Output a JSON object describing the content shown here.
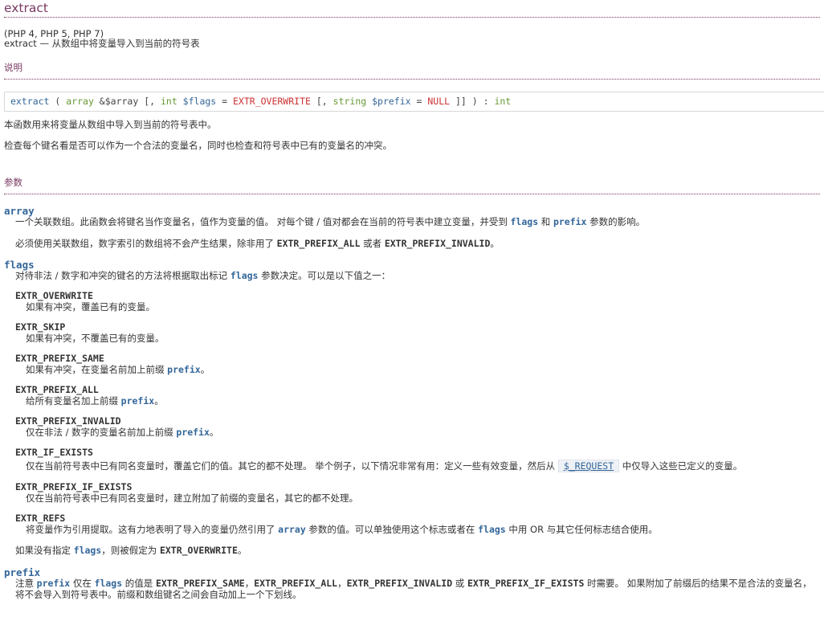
{
  "title": "extract",
  "versions": "(PHP 4, PHP 5, PHP 7)",
  "refpurpose": "extract — 从数组中将变量导入到当前的符号表",
  "section_description": "说明",
  "synopsis": {
    "func": "extract",
    "paren_open": " ( ",
    "t_array": "array",
    "amp_arr": " &$array",
    "bracket1": " [, ",
    "t_int": "int",
    "flags_var": " $flags",
    "eq1": " = ",
    "const_overwrite": "EXTR_OVERWRITE",
    "bracket2": " [, ",
    "t_string": "string",
    "prefix_var": " $prefix",
    "eq2": " = ",
    "const_null": "NULL",
    "closing": " ]] ) : ",
    "t_ret": "int"
  },
  "desc_p1": "本函数用来将变量从数组中导入到当前的符号表中。",
  "desc_p2": "检查每个键名看是否可以作为一个合法的变量名，同时也检查和符号表中已有的变量名的冲突。",
  "section_params": "参数",
  "params": {
    "array": {
      "name": "array",
      "d1_a": "一个关联数组。此函数会将键名当作变量名，值作为变量的值。 对每个键 / 值对都会在当前的符号表中建立变量，并受到 ",
      "d1_flags": "flags",
      "d1_and": " 和 ",
      "d1_prefix": "prefix",
      "d1_b": " 参数的影响。",
      "d2_a": "必须使用关联数组，数字索引的数组将不会产生结果，除非用了 ",
      "d2_c1": "EXTR_PREFIX_ALL",
      "d2_or": " 或者 ",
      "d2_c2": "EXTR_PREFIX_INVALID",
      "d2_end": "。"
    },
    "flags": {
      "name": "flags",
      "intro_a": "对待非法 / 数字和冲突的键名的方法将根据取出标记 ",
      "intro_flags": "flags",
      "intro_b": " 参数决定。可以是以下值之一：",
      "overwrite_name": "EXTR_OVERWRITE",
      "overwrite_desc": "如果有冲突，覆盖已有的变量。",
      "skip_name": "EXTR_SKIP",
      "skip_desc": "如果有冲突，不覆盖已有的变量。",
      "ps_name": "EXTR_PREFIX_SAME",
      "ps_desc_a": "如果有冲突，在变量名前加上前缀 ",
      "ps_prefix": "prefix",
      "ps_end": "。",
      "pa_name": "EXTR_PREFIX_ALL",
      "pa_desc_a": "给所有变量名加上前缀 ",
      "pa_prefix": "prefix",
      "pa_end": "。",
      "pi_name": "EXTR_PREFIX_INVALID",
      "pi_desc_a": "仅在非法 / 数字的变量名前加上前缀 ",
      "pi_prefix": "prefix",
      "pi_end": "。",
      "ie_name": "EXTR_IF_EXISTS",
      "ie_desc_a": "仅在当前符号表中已有同名变量时，覆盖它们的值。其它的都不处理。 举个例子，以下情况非常有用：定义一些有效变量，然后从 ",
      "ie_link": "$_REQUEST",
      "ie_desc_b": " 中仅导入这些已定义的变量。",
      "pie_name": "EXTR_PREFIX_IF_EXISTS",
      "pie_desc": "仅在当前符号表中已有同名变量时，建立附加了前缀的变量名，其它的都不处理。",
      "refs_name": "EXTR_REFS",
      "refs_desc_a": "将变量作为引用提取。这有力地表明了导入的变量仍然引用了 ",
      "refs_array": "array",
      "refs_desc_b": " 参数的值。可以单独使用这个标志或者在 ",
      "refs_flags": "flags",
      "refs_desc_c": " 中用 OR 与其它任何标志结合使用。",
      "default_a": "如果没有指定 ",
      "default_flags": "flags",
      "default_b": "，则被假定为 ",
      "default_const": "EXTR_OVERWRITE",
      "default_end": "。"
    },
    "prefix": {
      "name": "prefix",
      "d_a": "注意 ",
      "d_prefix": "prefix",
      "d_b": " 仅在 ",
      "d_flags": "flags",
      "d_c": " 的值是 ",
      "d_c1": "EXTR_PREFIX_SAME",
      "d_sep1": "，",
      "d_c2": "EXTR_PREFIX_ALL",
      "d_sep2": "，",
      "d_c3": "EXTR_PREFIX_INVALID",
      "d_or": " 或 ",
      "d_c4": "EXTR_PREFIX_IF_EXISTS",
      "d_d": " 时需要。 如果附加了前缀后的结果不是合法的变量名，将不会导入到符号表中。前缀和数组键名之间会自动加上一个下划线。"
    }
  }
}
